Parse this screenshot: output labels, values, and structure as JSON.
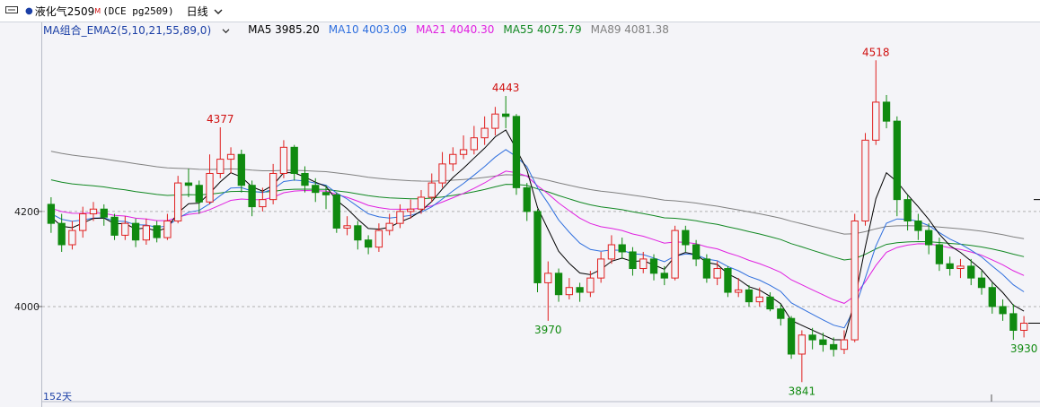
{
  "titlebar": {
    "instrument": "液化气2509",
    "main_flag": "M",
    "code": "(DCE pg2509)",
    "period": "日线"
  },
  "indicator_header": {
    "name": "MA组合_EMA2(5,10,21,55,89,0)",
    "items": [
      {
        "label": "MA5 3985.20",
        "color": "#000000"
      },
      {
        "label": "MA10 4003.09",
        "color": "#2f6fde"
      },
      {
        "label": "MA21 4040.30",
        "color": "#e020e0"
      },
      {
        "label": "MA55 4075.79",
        "color": "#118822"
      },
      {
        "label": "MA89 4081.38",
        "color": "#808080"
      }
    ]
  },
  "footer": {
    "day_count": "152天"
  },
  "chart_data": {
    "type": "candlestick",
    "y_ticks": [
      4200,
      4000
    ],
    "ylim": [
      3800,
      4560
    ],
    "annotations": [
      {
        "label": "4377",
        "index": 16,
        "kind": "high",
        "value": 4377
      },
      {
        "label": "4443",
        "index": 43,
        "kind": "high",
        "value": 4443
      },
      {
        "label": "3970",
        "index": 47,
        "kind": "low",
        "value": 3970
      },
      {
        "label": "3841",
        "index": 71,
        "kind": "low",
        "value": 3841
      },
      {
        "label": "4518",
        "index": 78,
        "kind": "high",
        "value": 4518
      },
      {
        "label": "3930",
        "index": 92,
        "kind": "low",
        "value": 3930
      }
    ],
    "series_colors": {
      "up": "#e02020",
      "down": "#108a10",
      "ma5": "#000000",
      "ma10": "#2f6fde",
      "ma21": "#e020e0",
      "ma55": "#118822",
      "ma89": "#808080"
    },
    "candles": [
      [
        4215,
        4175,
        4230,
        4155
      ],
      [
        4175,
        4130,
        4195,
        4115
      ],
      [
        4130,
        4160,
        4180,
        4120
      ],
      [
        4160,
        4195,
        4210,
        4145
      ],
      [
        4195,
        4205,
        4220,
        4180
      ],
      [
        4205,
        4188,
        4215,
        4170
      ],
      [
        4188,
        4150,
        4195,
        4140
      ],
      [
        4150,
        4175,
        4190,
        4140
      ],
      [
        4175,
        4140,
        4185,
        4125
      ],
      [
        4140,
        4170,
        4185,
        4130
      ],
      [
        4170,
        4145,
        4180,
        4135
      ],
      [
        4145,
        4180,
        4195,
        4140
      ],
      [
        4180,
        4260,
        4275,
        4175
      ],
      [
        4260,
        4255,
        4290,
        4230
      ],
      [
        4255,
        4220,
        4265,
        4195
      ],
      [
        4220,
        4280,
        4320,
        4215
      ],
      [
        4280,
        4310,
        4377,
        4270
      ],
      [
        4310,
        4320,
        4335,
        4280
      ],
      [
        4320,
        4255,
        4330,
        4240
      ],
      [
        4255,
        4210,
        4265,
        4190
      ],
      [
        4210,
        4225,
        4250,
        4200
      ],
      [
        4225,
        4280,
        4300,
        4215
      ],
      [
        4280,
        4335,
        4350,
        4270
      ],
      [
        4335,
        4280,
        4340,
        4265
      ],
      [
        4280,
        4255,
        4295,
        4240
      ],
      [
        4255,
        4240,
        4270,
        4220
      ],
      [
        4240,
        4235,
        4255,
        4205
      ],
      [
        4235,
        4165,
        4240,
        4155
      ],
      [
        4165,
        4170,
        4190,
        4150
      ],
      [
        4170,
        4140,
        4180,
        4120
      ],
      [
        4140,
        4125,
        4150,
        4110
      ],
      [
        4125,
        4160,
        4175,
        4115
      ],
      [
        4160,
        4175,
        4195,
        4150
      ],
      [
        4175,
        4200,
        4215,
        4165
      ],
      [
        4200,
        4205,
        4225,
        4185
      ],
      [
        4205,
        4230,
        4245,
        4195
      ],
      [
        4230,
        4260,
        4280,
        4220
      ],
      [
        4260,
        4300,
        4325,
        4250
      ],
      [
        4300,
        4320,
        4335,
        4285
      ],
      [
        4320,
        4330,
        4360,
        4310
      ],
      [
        4330,
        4355,
        4380,
        4320
      ],
      [
        4355,
        4375,
        4400,
        4340
      ],
      [
        4375,
        4405,
        4420,
        4360
      ],
      [
        4405,
        4400,
        4443,
        4375
      ],
      [
        4400,
        4250,
        4405,
        4235
      ],
      [
        4250,
        4200,
        4260,
        4180
      ],
      [
        4200,
        4050,
        4205,
        4030
      ],
      [
        4050,
        4070,
        4095,
        3970
      ],
      [
        4070,
        4025,
        4080,
        4010
      ],
      [
        4025,
        4040,
        4060,
        4015
      ],
      [
        4040,
        4030,
        4050,
        4010
      ],
      [
        4030,
        4060,
        4075,
        4020
      ],
      [
        4060,
        4100,
        4115,
        4050
      ],
      [
        4100,
        4130,
        4150,
        4090
      ],
      [
        4130,
        4115,
        4145,
        4100
      ],
      [
        4115,
        4080,
        4125,
        4065
      ],
      [
        4080,
        4100,
        4115,
        4070
      ],
      [
        4100,
        4070,
        4110,
        4055
      ],
      [
        4070,
        4060,
        4085,
        4045
      ],
      [
        4060,
        4160,
        4170,
        4055
      ],
      [
        4160,
        4130,
        4170,
        4115
      ],
      [
        4130,
        4100,
        4140,
        4085
      ],
      [
        4100,
        4060,
        4110,
        4050
      ],
      [
        4060,
        4080,
        4095,
        4045
      ],
      [
        4080,
        4030,
        4085,
        4020
      ],
      [
        4030,
        4035,
        4060,
        4020
      ],
      [
        4035,
        4010,
        4045,
        4000
      ],
      [
        4010,
        4020,
        4040,
        4000
      ],
      [
        4020,
        3995,
        4030,
        3990
      ],
      [
        3995,
        3975,
        4005,
        3960
      ],
      [
        3975,
        3900,
        3980,
        3890
      ],
      [
        3900,
        3940,
        3950,
        3841
      ],
      [
        3940,
        3930,
        3955,
        3910
      ],
      [
        3930,
        3920,
        3945,
        3905
      ],
      [
        3920,
        3910,
        3935,
        3895
      ],
      [
        3910,
        3930,
        3950,
        3900
      ],
      [
        3930,
        4180,
        4195,
        3925
      ],
      [
        4180,
        4350,
        4365,
        4170
      ],
      [
        4350,
        4430,
        4518,
        4340
      ],
      [
        4430,
        4390,
        4445,
        4375
      ],
      [
        4390,
        4225,
        4400,
        4190
      ],
      [
        4225,
        4180,
        4235,
        4160
      ],
      [
        4180,
        4160,
        4195,
        4140
      ],
      [
        4160,
        4130,
        4175,
        4110
      ],
      [
        4130,
        4090,
        4145,
        4075
      ],
      [
        4090,
        4080,
        4105,
        4065
      ],
      [
        4080,
        4085,
        4100,
        4060
      ],
      [
        4085,
        4060,
        4100,
        4045
      ],
      [
        4060,
        4040,
        4075,
        4025
      ],
      [
        4040,
        4000,
        4050,
        3985
      ],
      [
        4000,
        3985,
        4015,
        3970
      ],
      [
        3985,
        3950,
        4005,
        3930
      ],
      [
        3950,
        3965,
        3980,
        3935
      ]
    ]
  }
}
